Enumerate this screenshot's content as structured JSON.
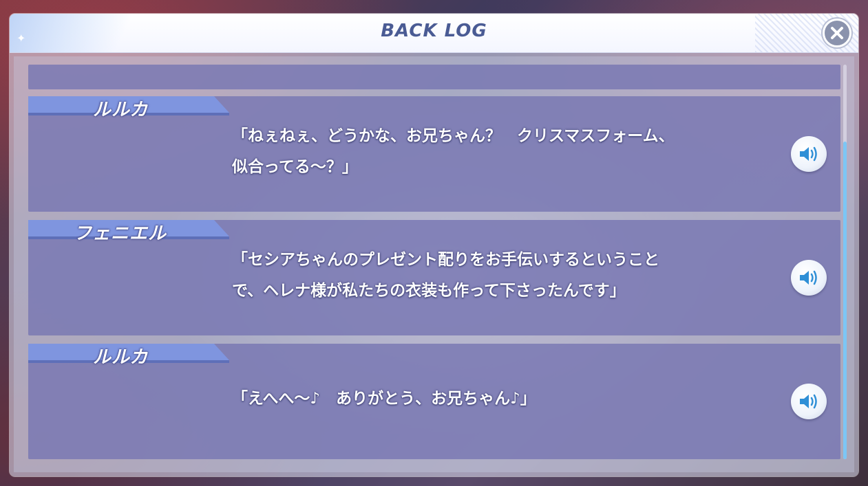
{
  "window": {
    "title": "BACK LOG",
    "close_icon": "close-icon",
    "sparkle_icon": "sparkle-icon"
  },
  "log": {
    "entries": [
      {
        "speaker": "ルルカ",
        "lines": [
          "「ねぇねぇ、どうかな、お兄ちゃん？　クリスマスフォーム、",
          "似合ってる～？」"
        ],
        "voice_icon": "speaker-icon"
      },
      {
        "speaker": "フェニエル",
        "lines": [
          "「セシアちゃんのプレゼント配りをお手伝いするということ",
          "で、ヘレナ様が私たちの衣装も作って下さったんです」"
        ],
        "voice_icon": "speaker-icon"
      },
      {
        "speaker": "ルルカ",
        "lines": [
          "「えへへ～♪　ありがとう、お兄ちゃん♪」"
        ],
        "voice_icon": "speaker-icon"
      }
    ]
  },
  "colors": {
    "title": "#4a5b94",
    "entry_bg": "#7876b2",
    "name_tab": "#7f95df",
    "scroll_thumb": "#7cc6f5",
    "voice_icon": "#2f8fd6"
  }
}
